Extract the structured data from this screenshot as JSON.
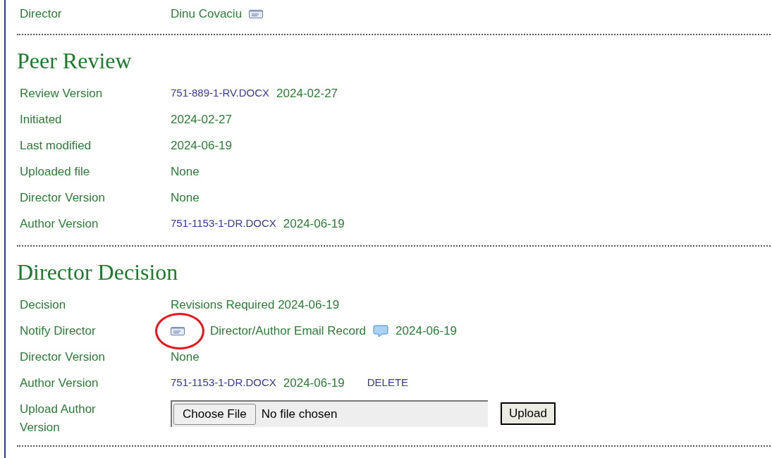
{
  "top_row": {
    "label": "Director",
    "parts": [
      {
        "kind": "text",
        "text": "Dinu Covaciu"
      },
      {
        "kind": "mail_icon"
      }
    ]
  },
  "sections": [
    {
      "title": "Peer Review",
      "rows": [
        {
          "label": "Review Version",
          "parts": [
            {
              "kind": "link",
              "text": "751-889-1-RV.DOCX"
            },
            {
              "kind": "text",
              "text": "2024-02-27"
            }
          ]
        },
        {
          "label": "Initiated",
          "parts": [
            {
              "kind": "text",
              "text": "2024-02-27"
            }
          ]
        },
        {
          "label": "Last modified",
          "parts": [
            {
              "kind": "text",
              "text": "2024-06-19"
            }
          ]
        },
        {
          "label": "Uploaded file",
          "parts": [
            {
              "kind": "text",
              "text": "None"
            }
          ]
        },
        {
          "label": "Director Version",
          "parts": [
            {
              "kind": "text",
              "text": "None"
            }
          ]
        },
        {
          "label": "Author Version",
          "parts": [
            {
              "kind": "link",
              "text": "751-1153-1-DR.DOCX"
            },
            {
              "kind": "text",
              "text": "2024-06-19"
            }
          ]
        }
      ]
    },
    {
      "title": "Director Decision",
      "rows": [
        {
          "label": "Decision",
          "parts": [
            {
              "kind": "text",
              "text": "Revisions Required 2024-06-19"
            }
          ]
        },
        {
          "label": "Notify Director",
          "parts": [
            {
              "kind": "mail_icon"
            },
            {
              "kind": "link_text",
              "text": "Director/Author Email Record"
            },
            {
              "kind": "note_icon"
            },
            {
              "kind": "text",
              "text": "2024-06-19"
            }
          ]
        },
        {
          "label": "Director Version",
          "parts": [
            {
              "kind": "text",
              "text": "None"
            }
          ]
        },
        {
          "label": "Author Version",
          "parts": [
            {
              "kind": "link",
              "text": "751-1153-1-DR.DOCX"
            },
            {
              "kind": "text",
              "text": "2024-06-19"
            },
            {
              "kind": "action_link",
              "text": "DELETE"
            }
          ]
        },
        {
          "label": "Upload Author Version",
          "parts": [
            {
              "kind": "file",
              "button": "Choose File",
              "status": "No file chosen"
            },
            {
              "kind": "button",
              "text": "Upload"
            }
          ]
        }
      ]
    }
  ]
}
